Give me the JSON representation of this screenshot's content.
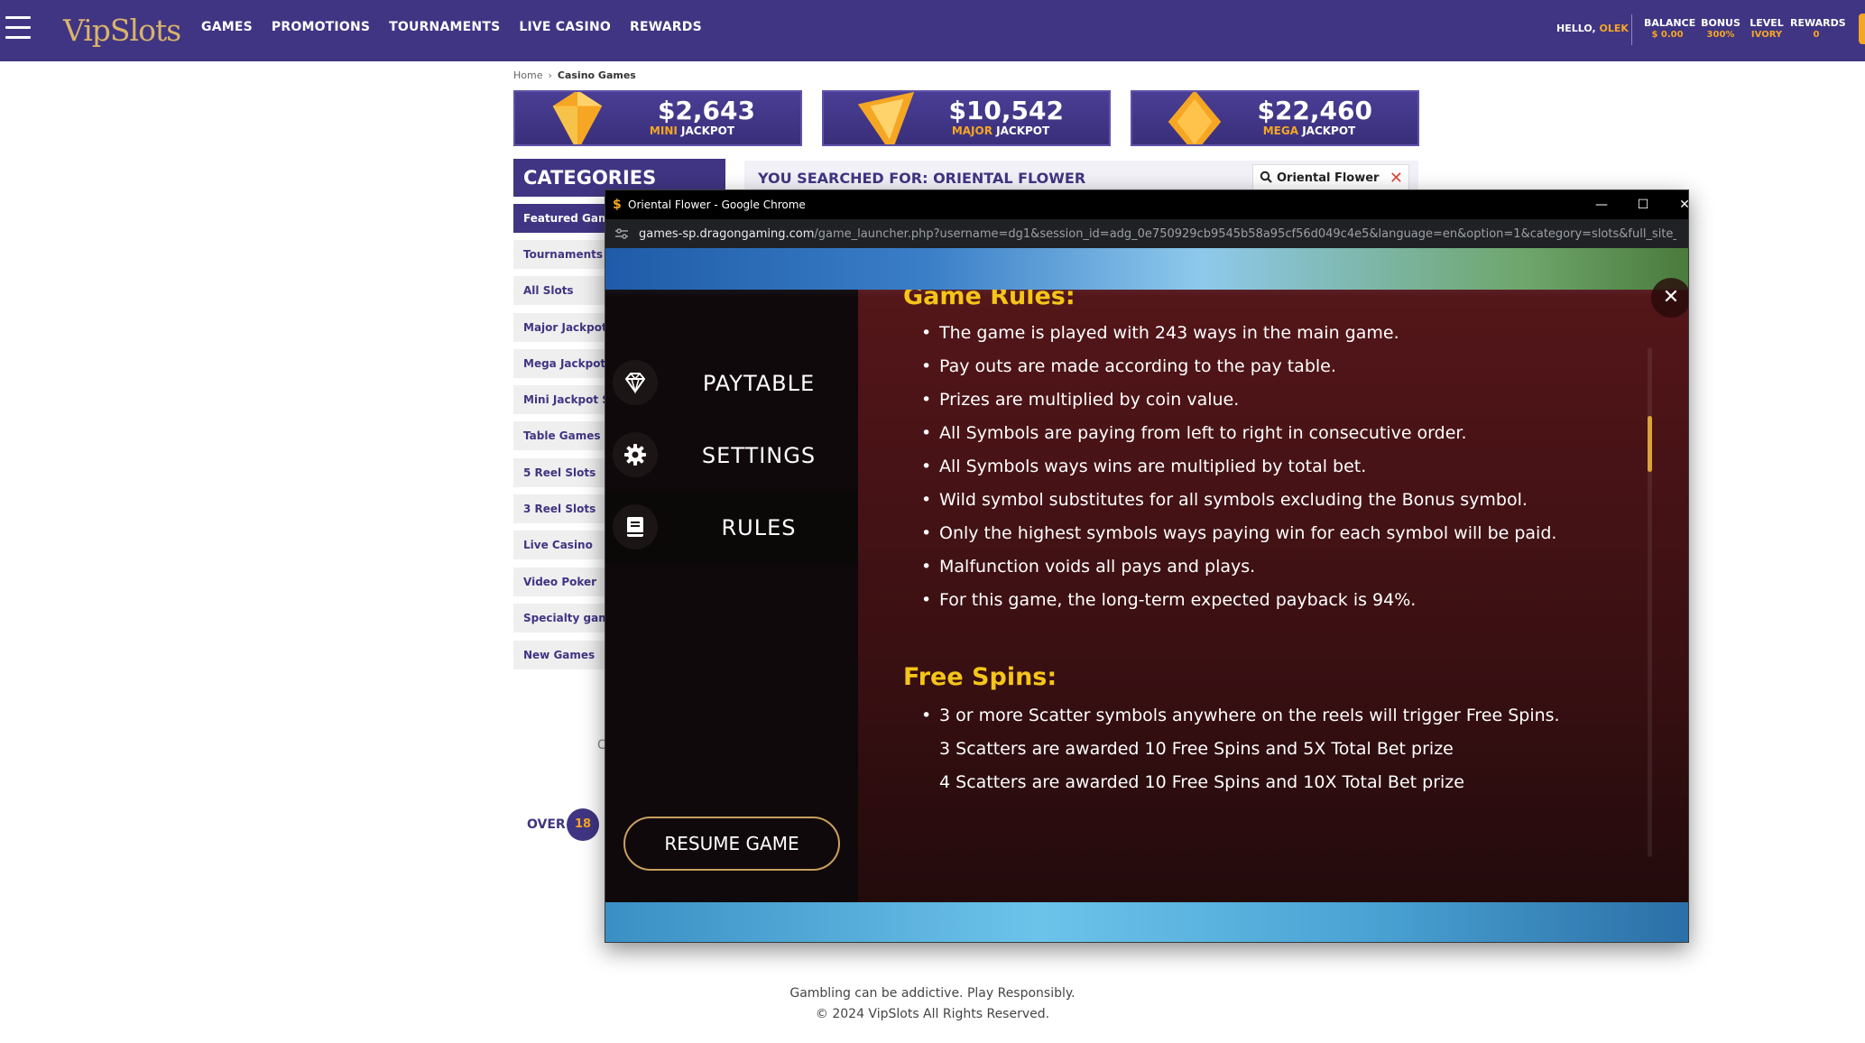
{
  "nav": {
    "logo": "VipSlots",
    "links": [
      "GAMES",
      "PROMOTIONS",
      "TOURNAMENTS",
      "LIVE CASINO",
      "REWARDS"
    ],
    "greeting": "HELLO,",
    "username": "OLEK",
    "stats": [
      {
        "label": "BALANCE",
        "value": "$ 0.00"
      },
      {
        "label": "BONUS",
        "value": "300%"
      },
      {
        "label": "LEVEL",
        "value": "IVORY"
      },
      {
        "label": "REWARDS",
        "value": "0"
      }
    ]
  },
  "breadcrumb": {
    "home": "Home",
    "current": "Casino Games"
  },
  "jackpots": [
    {
      "amount": "$2,643",
      "tier": "MINI",
      "suffix": "JACKPOT"
    },
    {
      "amount": "$10,542",
      "tier": "MAJOR",
      "suffix": "JACKPOT"
    },
    {
      "amount": "$22,460",
      "tier": "MEGA",
      "suffix": "JACKPOT"
    }
  ],
  "categories": {
    "title": "CATEGORIES",
    "items": [
      "Featured Games",
      "Tournaments",
      "All Slots",
      "Major Jackpot",
      "Mega Jackpot Slots",
      "Mini Jackpot Slots",
      "Table Games",
      "5 Reel Slots",
      "3 Reel Slots",
      "Live Casino",
      "Video Poker",
      "Specialty games",
      "New Games"
    ]
  },
  "search": {
    "title": "YOU SEARCHED FOR: ORIENTAL FLOWER",
    "query": "Oriental Flower"
  },
  "over": {
    "label": "OVER",
    "badge": "18"
  },
  "stray": "C",
  "footer": {
    "line1": "Gambling can be addictive. Play Responsibly.",
    "line2": "© 2024 VipSlots All Rights Reserved."
  },
  "chrome": {
    "title": "Oriental Flower - Google Chrome",
    "url_host": "games-sp.dragongaming.com",
    "url_path": "/game_launcher.php?username=dg1&session_id=adg_0e750929cb9545b58a95cf56d049c4e5&language=en&option=1&category=slots&full_site_code=..."
  },
  "game": {
    "menu": [
      "PAYTABLE",
      "SETTINGS",
      "RULES"
    ],
    "resume": "RESUME GAME",
    "rules_heading": "Game Rules:",
    "rules": [
      "The game is played with 243 ways in the main game.",
      "Pay outs are made according to the pay table.",
      "Prizes are multiplied by coin value.",
      "All Symbols are paying from left to right in consecutive order.",
      "All Symbols ways wins are multiplied by total bet.",
      "Wild symbol substitutes for all symbols excluding the Bonus symbol.",
      "Only the highest symbols ways paying win for each symbol will be paid.",
      "Malfunction voids all pays and plays.",
      "For this game, the long-term expected payback is 94%."
    ],
    "free_heading": "Free Spins:",
    "free_rules": [
      "3 or more Scatter symbols anywhere on the reels will trigger Free Spins.",
      "3 Scatters are awarded 10 Free Spins and 5X Total Bet prize",
      "4 Scatters are awarded 10 Free Spins and 10X Total Bet prize"
    ]
  }
}
